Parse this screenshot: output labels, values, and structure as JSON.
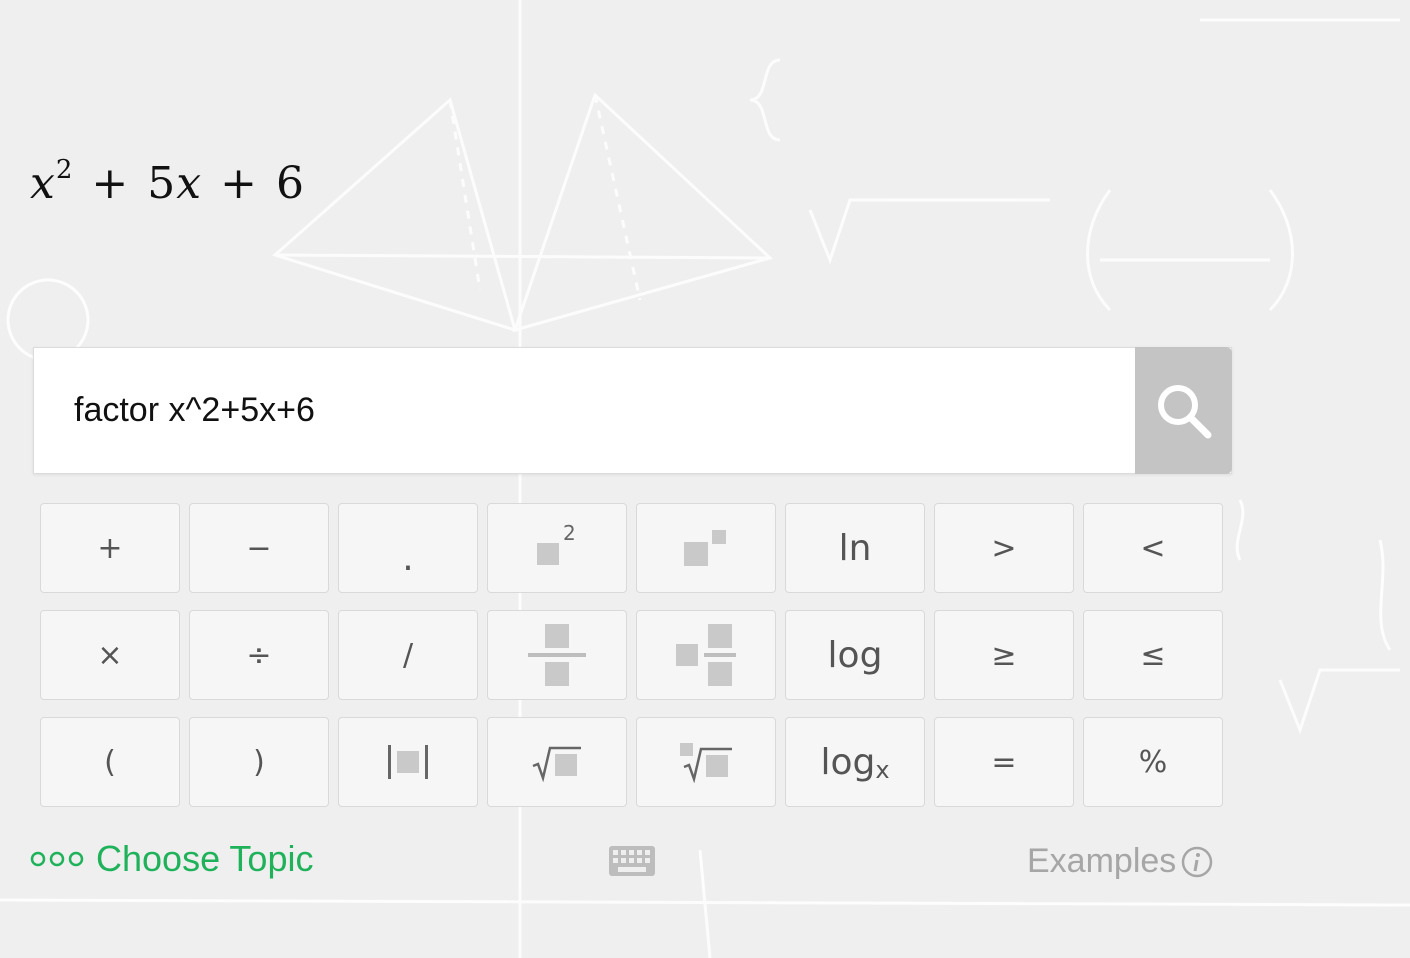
{
  "preview": {
    "var": "x",
    "exp": "2",
    "plus1": "+",
    "term": "5",
    "var2": "x",
    "plus2": "+",
    "const": "6"
  },
  "search": {
    "value": "factor x^2+5x+6",
    "button_icon": "search-icon"
  },
  "keypad": {
    "plus": "+",
    "minus": "−",
    "dot": ".",
    "square_exp": "2",
    "ln": "ln",
    "gt": ">",
    "lt": "<",
    "times": "×",
    "divide": "÷",
    "slash": "/",
    "log": "log",
    "ge": "≥",
    "le": "≤",
    "lparen": "(",
    "rparen": ")",
    "logx_base": "log",
    "logx_sub": "x",
    "equals": "=",
    "percent": "%"
  },
  "footer": {
    "choose_topic": "Choose Topic",
    "examples": "Examples"
  },
  "colors": {
    "accent": "#1fb25a",
    "search_button": "#c4c4c4",
    "muted": "#a6a6a6"
  }
}
